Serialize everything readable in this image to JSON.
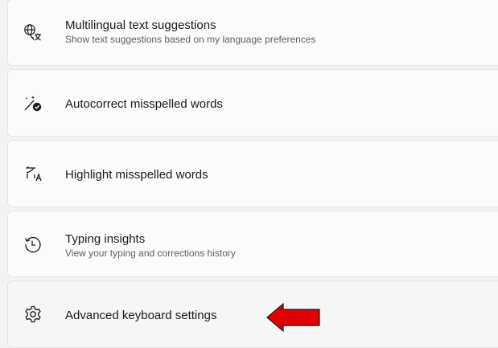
{
  "settings": {
    "items": [
      {
        "icon": "globe-language-icon",
        "title": "Multilingual text suggestions",
        "subtitle": "Show text suggestions based on my language preferences"
      },
      {
        "icon": "autocorrect-icon",
        "title": "Autocorrect misspelled words"
      },
      {
        "icon": "highlight-spelling-icon",
        "title": "Highlight misspelled words"
      },
      {
        "icon": "history-icon",
        "title": "Typing insights",
        "subtitle": "View your typing and corrections history"
      },
      {
        "icon": "gear-icon",
        "title": "Advanced keyboard settings"
      }
    ]
  },
  "annotation": {
    "arrow_color": "#e00000",
    "arrow_direction": "left"
  }
}
